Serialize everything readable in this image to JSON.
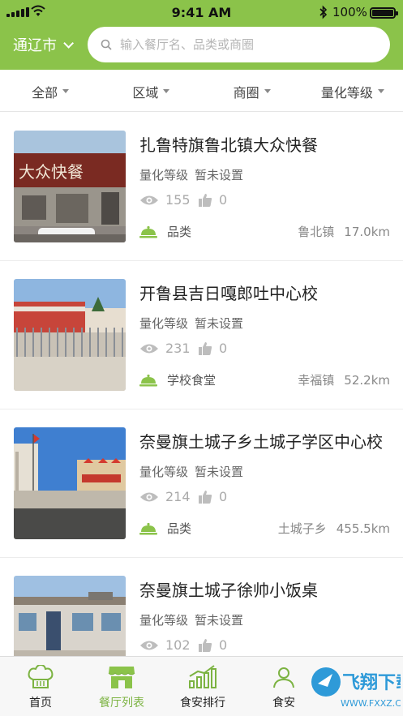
{
  "status_bar": {
    "time": "9:41 AM",
    "battery": "100%"
  },
  "header": {
    "city": "通辽市",
    "search_placeholder": "输入餐厅名、品类或商圈"
  },
  "filters": [
    "全部",
    "区域",
    "商圈",
    "量化等级"
  ],
  "restaurants": [
    {
      "name": "扎鲁特旗鲁北镇大众快餐",
      "grade_label": "量化等级",
      "grade_value": "暂未设置",
      "views": "155",
      "likes": "0",
      "category": "品类",
      "town": "鲁北镇",
      "distance": "17.0km"
    },
    {
      "name": "开鲁县吉日嘎郎吐中心校",
      "grade_label": "量化等级",
      "grade_value": "暂未设置",
      "views": "231",
      "likes": "0",
      "category": "学校食堂",
      "town": "幸福镇",
      "distance": "52.2km"
    },
    {
      "name": "奈曼旗土城子乡土城子学区中心校",
      "grade_label": "量化等级",
      "grade_value": "暂未设置",
      "views": "214",
      "likes": "0",
      "category": "品类",
      "town": "土城子乡",
      "distance": "455.5km"
    },
    {
      "name": "奈曼旗土城子徐帅小饭桌",
      "grade_label": "量化等级",
      "grade_value": "暂未设置",
      "views": "102",
      "likes": "0",
      "category": "",
      "town": "",
      "distance": ""
    }
  ],
  "tabs": [
    {
      "label": "首页",
      "icon": "chef-hat-icon",
      "active": false
    },
    {
      "label": "餐厅列表",
      "icon": "storefront-icon",
      "active": true
    },
    {
      "label": "食安排行",
      "icon": "bar-chart-icon",
      "active": false
    },
    {
      "label": "食安",
      "icon": "user-icon",
      "active": false
    }
  ],
  "watermark": {
    "text": "飞翔下载",
    "url": "WWW.FXXZ.COM"
  },
  "colors": {
    "primary": "#8bc34a",
    "active_tab": "#7cb342"
  }
}
